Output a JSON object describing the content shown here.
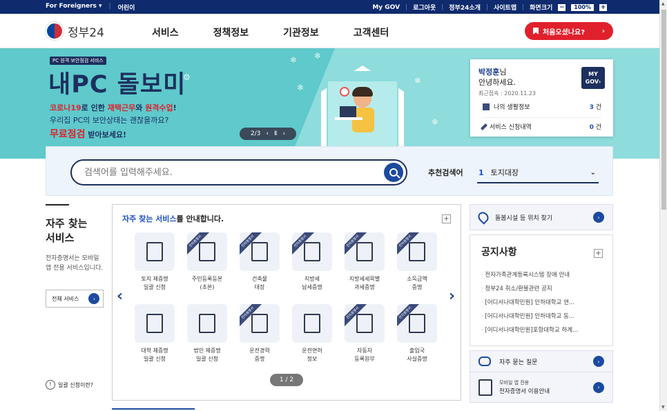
{
  "topbar": {
    "foreigners": "For Foreigners ▾",
    "kids": "어린이",
    "mygov": "My GOV",
    "logout": "로그아웃",
    "intro": "정부24소개",
    "sitemap": "사이트맵",
    "screen_size": "화면크기",
    "zoom": "100%",
    "minus": "−",
    "plus": "+"
  },
  "header": {
    "logo": "정부24",
    "nav": [
      "서비스",
      "정책정보",
      "기관정보",
      "고객센터"
    ],
    "first_visit": "처음오셨나요?",
    "first_visit_arrow": "›"
  },
  "banner": {
    "tag": "PC 원격 보안점검 서비스",
    "hero": "내PC 돌보미",
    "line1_a": "코로나19",
    "line1_b": "로 인한 ",
    "line1_c": "재택근무",
    "line1_d": "와 ",
    "line1_e": "원격수업",
    "line1_f": "!",
    "line2": "우리집 PC의 보안상태는 괜찮을까요?",
    "line3_a": "무료점검",
    "line3_b": " 받아보세요!",
    "pager": "2/3",
    "prev": "‹",
    "pause": "Ⅱ",
    "next": "›"
  },
  "user": {
    "name": "박정훈",
    "suffix": "님",
    "greeting": "안녕하세요.",
    "last_login": "최근접속 : 2020.11.23",
    "mygov_btn_1": "MY",
    "mygov_btn_2": "GOV›",
    "life_info": "나의 생활정보",
    "life_count": "3",
    "svc_history": "서비스 신청내역",
    "svc_count": "0",
    "unit": "건"
  },
  "search": {
    "placeholder": "검색어를 입력해주세요.",
    "rec_label": "추천검색어",
    "rec_num": "1",
    "rec_term": "토지대장",
    "chev": "⌄"
  },
  "left": {
    "title_1": "자주 찾는",
    "title_2": "서비스",
    "desc": "전자증명서는 모바일 앱 전용 서비스입니다.",
    "all_btn": "전체 서비스",
    "help": "일괄 신청이란?",
    "help_q": "!"
  },
  "services": {
    "title_a": "자주 찾는 서비스",
    "title_b": "를 안내합니다.",
    "plus": "+",
    "prev": "‹",
    "next": "›",
    "page": "1 / 2",
    "ribbon": "전자증명서",
    "items": [
      {
        "l1": "토지 제증명",
        "l2": "일괄 신청",
        "ribbon": false
      },
      {
        "l1": "주민등록등본",
        "l2": "(초본)",
        "ribbon": true
      },
      {
        "l1": "건축물",
        "l2": "대장",
        "ribbon": true
      },
      {
        "l1": "지방세",
        "l2": "납세증명",
        "ribbon": true
      },
      {
        "l1": "지방세세목별",
        "l2": "과세증명",
        "ribbon": true
      },
      {
        "l1": "소득금액",
        "l2": "증명",
        "ribbon": true
      },
      {
        "l1": "대학 제증명",
        "l2": "일괄 신청",
        "ribbon": false
      },
      {
        "l1": "법인 제증명",
        "l2": "일괄 신청",
        "ribbon": false
      },
      {
        "l1": "운전경력",
        "l2": "증명",
        "ribbon": true
      },
      {
        "l1": "운전면허",
        "l2": "정보",
        "ribbon": false
      },
      {
        "l1": "자동차",
        "l2": "등록원부",
        "ribbon": true
      },
      {
        "l1": "출입국",
        "l2": "사실증명",
        "ribbon": true
      }
    ]
  },
  "right": {
    "map_link": "돌봄시설 등 위치 찾기",
    "notice_title": "공지사항",
    "notice_plus": "+",
    "notices": [
      "전자가족관계등록시스템 장애 안내",
      "정부24 취소/환불관련 공지",
      "[어디서나대학민원] 인하대학교 연...",
      "[어디서나대학민원] 인하대학교 동...",
      "[어디서나대학민원]포항대학교 하계..."
    ],
    "faq": "자주 묻는 질문",
    "mobile_small": "모바일 앱 전용",
    "mobile_main": "전자증명서 이용안내",
    "go": "›"
  },
  "colors": {
    "navy": "#0f2b6e",
    "accent_red": "#e0212d",
    "banner_teal": "#5fc9cb",
    "blue": "#1c4a9f"
  }
}
